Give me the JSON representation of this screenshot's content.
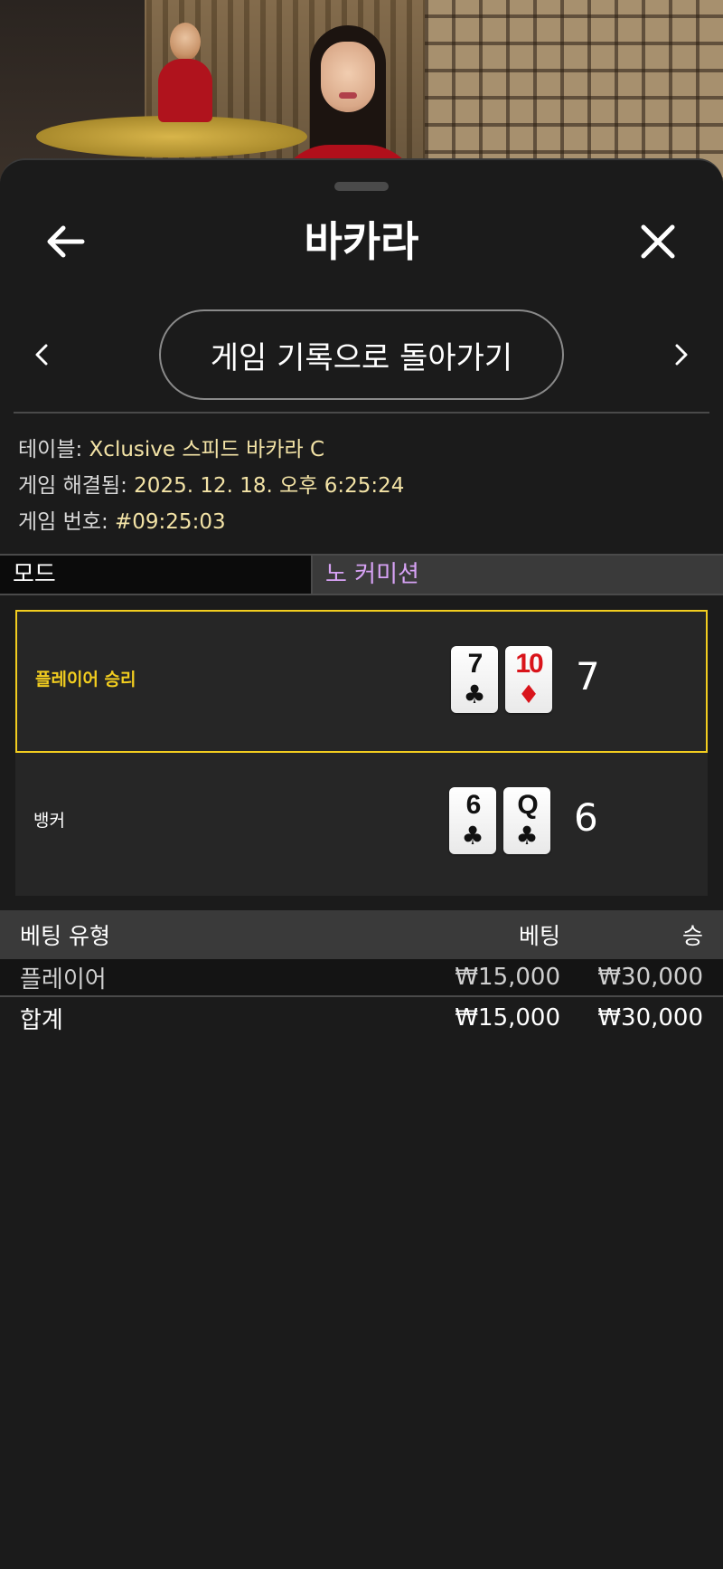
{
  "header": {
    "title": "바카라"
  },
  "nav": {
    "back_to_history_label": "게임 기록으로 돌아가기"
  },
  "info": {
    "table_label": "테이블: ",
    "table_value": "Xclusive 스피드 바카라 C",
    "resolved_label": "게임 해결됨: ",
    "resolved_value": "2025. 12. 18. 오후 6:25:24",
    "number_label": "게임 번호: ",
    "number_value": "#09:25:03"
  },
  "mode": {
    "label": "모드",
    "value": "노 커미션"
  },
  "hands": {
    "player": {
      "label": "플레이어 승리",
      "cards": [
        {
          "rank": "7",
          "suit": "♣",
          "color": "black"
        },
        {
          "rank": "10",
          "suit": "♦",
          "color": "red"
        }
      ],
      "score": "7"
    },
    "banker": {
      "label": "뱅커",
      "cards": [
        {
          "rank": "6",
          "suit": "♣",
          "color": "black"
        },
        {
          "rank": "Q",
          "suit": "♣",
          "color": "black"
        }
      ],
      "score": "6"
    }
  },
  "bets": {
    "headers": {
      "type": "베팅 유형",
      "bet": "베팅",
      "win": "승"
    },
    "rows": [
      {
        "type": "플레이어",
        "bet": "₩15,000",
        "win": "₩30,000"
      }
    ],
    "total": {
      "type": "합계",
      "bet": "₩15,000",
      "win": "₩30,000"
    }
  },
  "colors": {
    "accent_yellow": "#f2cd1f",
    "mode_value": "#d7a2f5",
    "info_value": "#f3e3a6",
    "background": "#1b1b1b"
  },
  "icons": {
    "back": "arrow-left-icon",
    "close": "close-icon",
    "prev": "chevron-left-icon",
    "next": "chevron-right-icon"
  }
}
